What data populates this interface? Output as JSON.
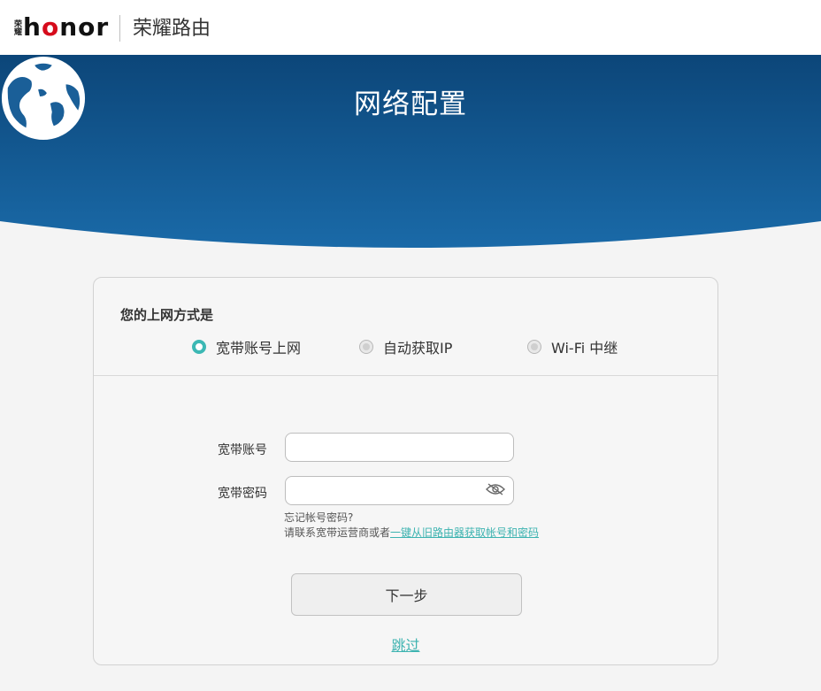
{
  "header": {
    "logo_cn": "荣耀",
    "logo_text_h": "h",
    "logo_text_o1": "o",
    "logo_text_n": "n",
    "logo_text_o2": "o",
    "logo_text_r": "r",
    "product_title": "荣耀路由"
  },
  "banner": {
    "title": "网络配置",
    "icon": "globe-icon"
  },
  "form": {
    "section_label": "您的上网方式是",
    "options": [
      {
        "label": "宽带账号上网",
        "selected": true
      },
      {
        "label": "自动获取IP",
        "selected": false
      },
      {
        "label": "Wi-Fi 中继",
        "selected": false
      }
    ],
    "account_label": "宽带账号",
    "account_value": "",
    "password_label": "宽带密码",
    "password_value": "",
    "hint_line1": "忘记帐号密码?",
    "hint_prefix": "请联系宽带运营商或者",
    "hint_link": "一键从旧路由器获取帐号和密码",
    "next_button": "下一步",
    "skip_link": "跳过"
  },
  "colors": {
    "banner_dark": "#0d4a80",
    "banner_light": "#1a6aa8",
    "accent": "#3cb8b4",
    "page_bg": "#f4f4f4"
  }
}
